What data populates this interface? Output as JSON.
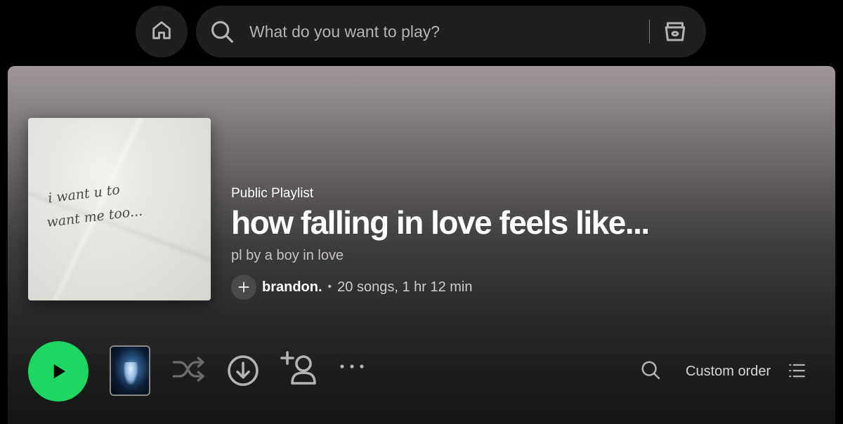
{
  "topbar": {
    "search_placeholder": "What do you want to play?",
    "icons": [
      "home-icon",
      "search-icon",
      "browse-icon"
    ]
  },
  "playlist": {
    "type_label": "Public Playlist",
    "title": "how falling in love feels like...",
    "description": "pl by a boy in love",
    "owner": "brandon.",
    "stats": "20 songs, 1 hr 12 min",
    "separator": "•",
    "cover_text_line1": "i want u to",
    "cover_text_line2": "want me too..."
  },
  "actions": {
    "sort_label": "Custom order",
    "icons": [
      "play-icon",
      "shuffle-icon",
      "download-icon",
      "add-user-icon",
      "more-icon",
      "search-icon",
      "list-icon"
    ]
  },
  "colors": {
    "accent": "#1ed760",
    "background": "#000000",
    "surface": "#1f1f1f"
  }
}
